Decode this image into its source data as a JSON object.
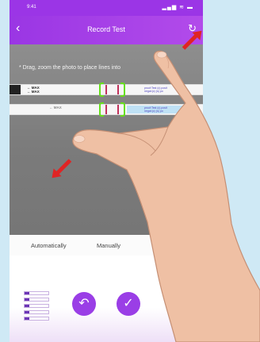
{
  "status_bar": {
    "time": "9:41",
    "icons": "▂▄▆ ≋ ▬"
  },
  "nav": {
    "back_glyph": "‹",
    "title": "Record Test",
    "reset_glyph": "↻"
  },
  "photo": {
    "instruction": "* Drag, zoom the photo to place lines into",
    "strip_top_label": "← MAX\n← MAX",
    "strip_bottom_label": "← MAX",
    "strip_tail_text": "proof:Test (c) posit\nnegat:(c) (s) po"
  },
  "modes": {
    "auto_label": "Automatically",
    "manual_label": "Manually"
  },
  "actions": {
    "undo_glyph": "↶",
    "confirm_glyph": "✓"
  },
  "colors": {
    "accent": "#9b35e6",
    "bracket": "#66e01a",
    "arrow": "#e02424",
    "test_line": "#c0305a"
  }
}
